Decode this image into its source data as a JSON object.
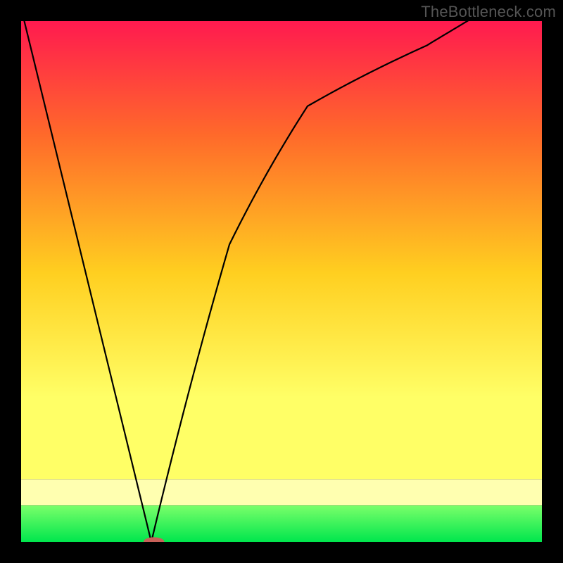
{
  "watermark": "TheBottleneck.com",
  "colors": {
    "frame": "#000000",
    "curve": "#000000",
    "marker_fill": "#c86058",
    "gradient": {
      "top": "#ff1a4f",
      "upper": "#ff6a2a",
      "mid": "#ffcf20",
      "lower": "#ffff66",
      "pale_band": "#ffffb0",
      "green_top": "#7aff6a",
      "green_bottom": "#00e64d"
    }
  },
  "chart_data": {
    "type": "line",
    "title": "",
    "xlabel": "",
    "ylabel": "",
    "xlim": [
      0,
      100
    ],
    "ylim": [
      0,
      100
    ],
    "grid": false,
    "legend": false,
    "x": [
      0,
      1,
      2,
      3,
      4,
      5,
      6,
      7,
      8,
      9,
      10,
      11,
      12,
      13,
      14,
      15,
      16,
      17,
      18,
      19,
      20,
      21,
      22,
      23,
      24,
      25,
      26,
      27,
      28,
      29,
      30,
      31,
      32,
      33,
      34,
      35,
      36,
      37,
      38,
      39,
      40,
      41,
      42,
      43,
      44,
      45,
      46,
      47,
      48,
      49,
      50,
      51,
      52,
      53,
      54,
      55,
      56,
      57,
      58,
      59,
      60,
      61,
      62,
      63,
      64,
      65,
      66,
      67,
      68,
      69,
      70,
      71,
      72,
      73,
      74,
      75,
      76,
      77,
      78,
      79,
      80,
      81,
      82,
      83,
      84,
      85,
      86,
      87,
      88,
      89,
      90,
      91,
      92,
      93,
      94,
      95,
      96,
      97,
      98,
      99,
      100
    ],
    "values": [
      102.5,
      98.4,
      94.3,
      90.2,
      86.1,
      82.0,
      77.9,
      73.8,
      69.7,
      65.6,
      61.5,
      57.4,
      53.3,
      49.2,
      45.1,
      41.0,
      36.9,
      32.8,
      28.7,
      24.6,
      20.5,
      16.4,
      12.3,
      8.2,
      4.1,
      0.0,
      4.173,
      8.29,
      12.351,
      16.358,
      20.311,
      24.212,
      28.06,
      31.859,
      35.608,
      39.308,
      42.96,
      46.566,
      50.126,
      53.641,
      57.112,
      59.123,
      61.095,
      63.029,
      64.927,
      66.79,
      68.618,
      70.413,
      72.176,
      73.907,
      75.607,
      77.277,
      78.917,
      80.529,
      82.113,
      83.67,
      84.242,
      84.808,
      85.367,
      85.92,
      86.467,
      87.007,
      87.542,
      88.071,
      88.594,
      89.112,
      89.624,
      90.131,
      90.632,
      91.128,
      91.619,
      92.105,
      92.587,
      93.063,
      93.534,
      94.001,
      94.463,
      94.921,
      95.374,
      96.0,
      96.6,
      97.2,
      97.8,
      98.4,
      99.0,
      99.6,
      100.2,
      100.8,
      101.4,
      102.0,
      102.6,
      103.2,
      103.8,
      104.4,
      105.0,
      105.6,
      106.2,
      106.8,
      107.4,
      108.0,
      108.6
    ],
    "marker": {
      "x": 25.5,
      "y": 0,
      "rx": 2.0,
      "ry": 0.9
    },
    "background_bands": [
      {
        "from": 100,
        "to": 12,
        "type": "gradient"
      },
      {
        "from": 12,
        "to": 7,
        "type": "pale"
      },
      {
        "from": 7,
        "to": 0,
        "type": "green"
      }
    ]
  }
}
